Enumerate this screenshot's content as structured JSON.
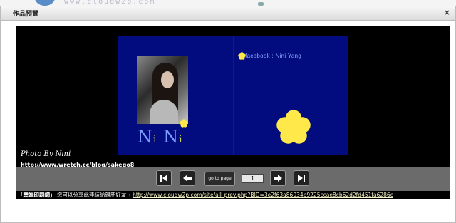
{
  "background": {
    "ghost_url": "www.cloudw2p.com"
  },
  "dialog": {
    "title": "作品預覽",
    "close_glyph": "×"
  },
  "book": {
    "cover_name_big_n1": "N",
    "cover_name_small_i1": "i",
    "cover_name_big_n2": " N",
    "cover_name_small_i2": "i",
    "facebook_text": "facebook : Nini Yang"
  },
  "credit": {
    "photo_by": "Photo By Nini",
    "url": "http://www.wretch.cc/blog/sakego8"
  },
  "controls": {
    "goto_label": "go to page",
    "page_number": "1"
  },
  "footer": {
    "brand": "「雲端印刷網」",
    "share_text": " 您可以分享此連結給親朋好友→ ",
    "share_link": "http://www.cloudw2p.com/site/all_prev.php?BID=3e2f63a86034b9225ccae8cb62d2fd451fa6286c"
  },
  "colors": {
    "book_background": "#020c7f",
    "flower": "#ffe84a",
    "controlbar": "#6b6b6b"
  }
}
